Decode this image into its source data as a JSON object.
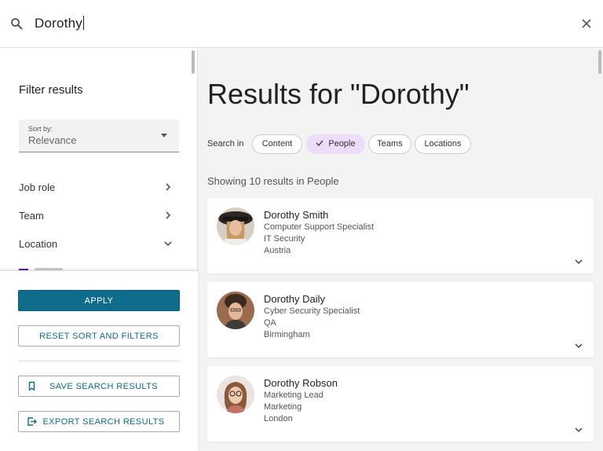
{
  "search": {
    "query": "Dorothy"
  },
  "sidebar": {
    "title": "Filter results",
    "sort": {
      "label": "Sort by:",
      "value": "Relevance"
    },
    "filters": [
      {
        "label": "Job role",
        "state": "collapsed"
      },
      {
        "label": "Team",
        "state": "collapsed"
      },
      {
        "label": "Location",
        "state": "expanded"
      }
    ],
    "actions": {
      "apply": "APPLY",
      "reset": "RESET SORT AND FILTERS",
      "save": "SAVE SEARCH RESULTS",
      "export": "EXPORT SEARCH RESULTS"
    }
  },
  "main": {
    "title": "Results for \"Dorothy\"",
    "search_in_label": "Search in",
    "chips": [
      {
        "label": "Content",
        "active": false
      },
      {
        "label": "People",
        "active": true
      },
      {
        "label": "Teams",
        "active": false
      },
      {
        "label": "Locations",
        "active": false
      }
    ],
    "showing": "Showing 10 results in People",
    "results": [
      {
        "name": "Dorothy Smith",
        "role": "Computer Support Specialist",
        "team": "IT Security",
        "location": "Austria"
      },
      {
        "name": "Dorothy Daily",
        "role": "Cyber Security Specialist",
        "team": "QA",
        "location": "Birmingham"
      },
      {
        "name": "Dorothy Robson",
        "role": "Marketing Lead",
        "team": "Marketing",
        "location": "London"
      }
    ]
  },
  "colors": {
    "accent": "#0f6c8a",
    "chip_active": "#ecdcf7",
    "location_checkbox": "#6a1ab8"
  }
}
